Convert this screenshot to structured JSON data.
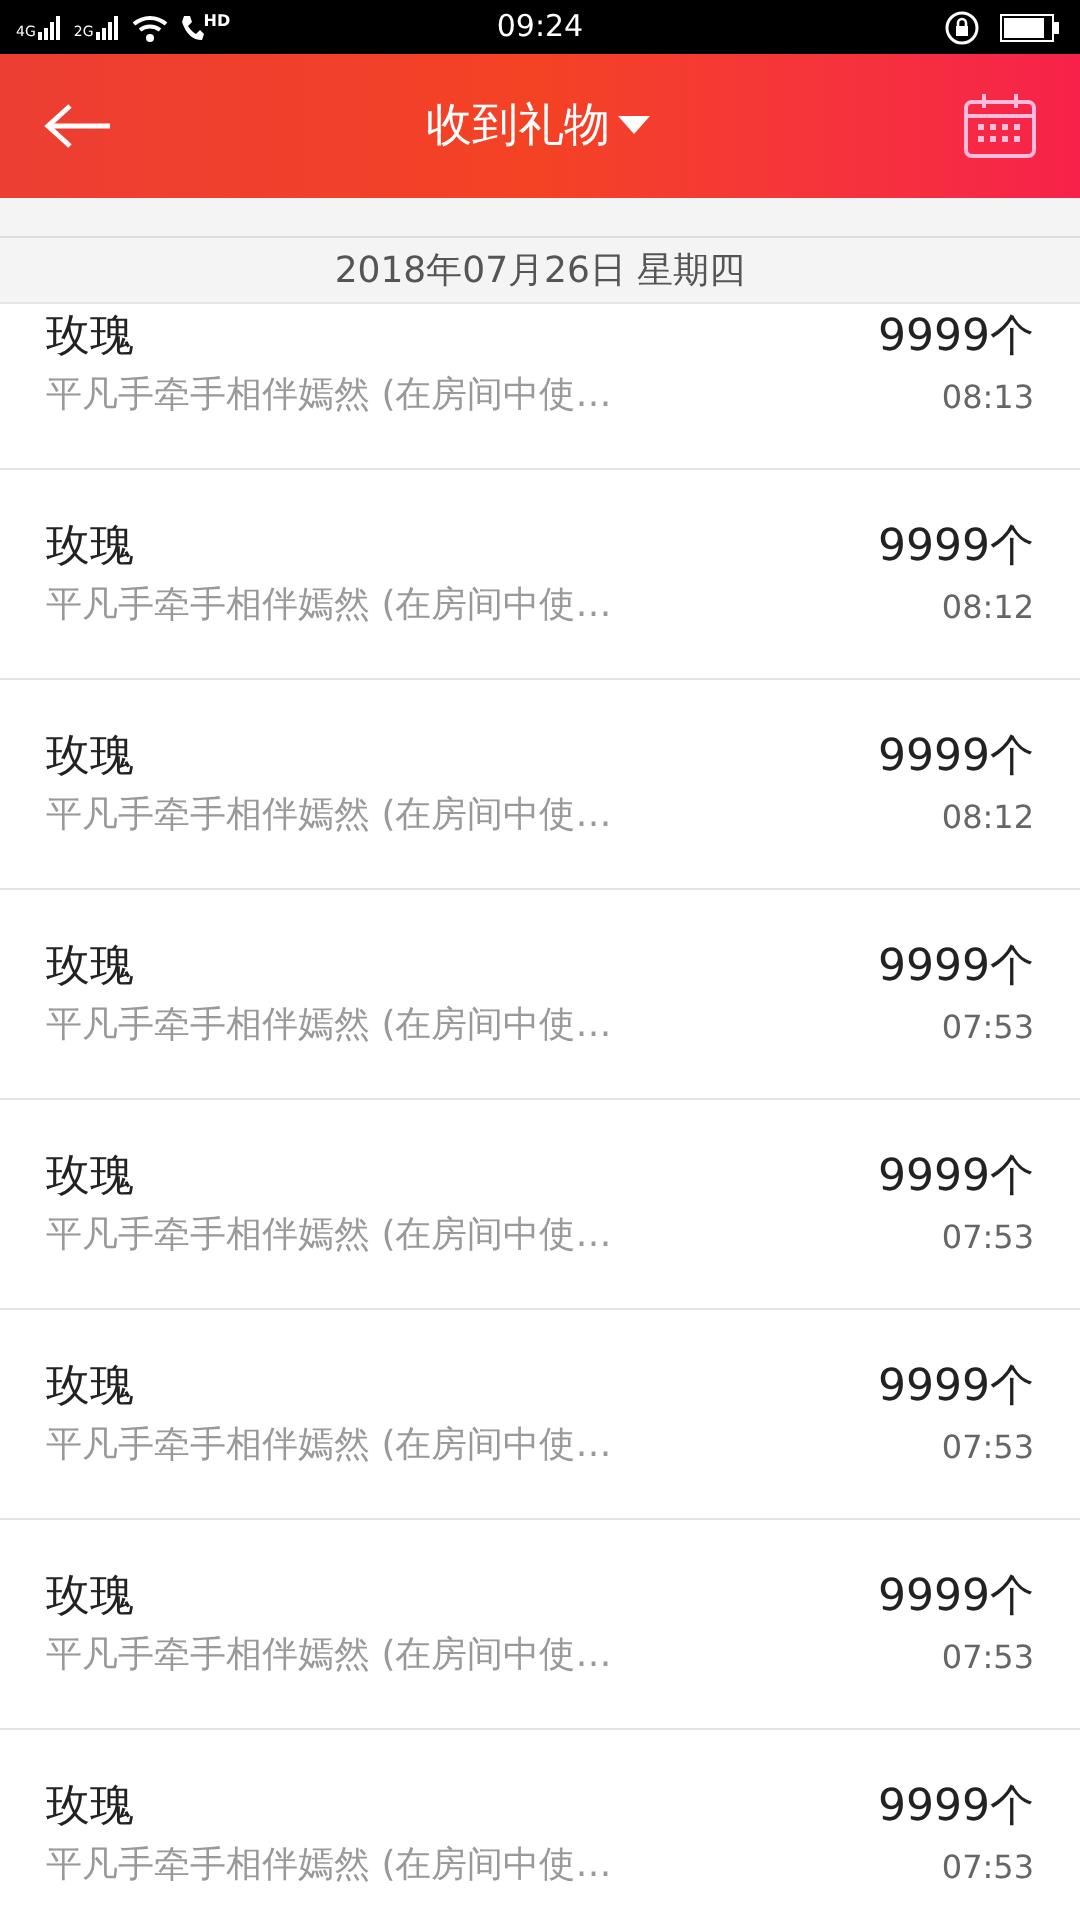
{
  "status_bar": {
    "time": "09:24",
    "network_1": "4G",
    "network_2": "2G",
    "call_label": "HD"
  },
  "header": {
    "title": "收到礼物"
  },
  "date_header": "2018年07月26日 星期四",
  "rows": [
    {
      "name": "玫瑰",
      "detail": "平凡手牵手相伴嫣然 (在房间中使…",
      "count": "9999个",
      "time": "08:13"
    },
    {
      "name": "玫瑰",
      "detail": "平凡手牵手相伴嫣然 (在房间中使…",
      "count": "9999个",
      "time": "08:12"
    },
    {
      "name": "玫瑰",
      "detail": "平凡手牵手相伴嫣然 (在房间中使…",
      "count": "9999个",
      "time": "08:12"
    },
    {
      "name": "玫瑰",
      "detail": "平凡手牵手相伴嫣然 (在房间中使…",
      "count": "9999个",
      "time": "07:53"
    },
    {
      "name": "玫瑰",
      "detail": "平凡手牵手相伴嫣然 (在房间中使…",
      "count": "9999个",
      "time": "07:53"
    },
    {
      "name": "玫瑰",
      "detail": "平凡手牵手相伴嫣然 (在房间中使…",
      "count": "9999个",
      "time": "07:53"
    },
    {
      "name": "玫瑰",
      "detail": "平凡手牵手相伴嫣然 (在房间中使…",
      "count": "9999个",
      "time": "07:53"
    },
    {
      "name": "玫瑰",
      "detail": "平凡手牵手相伴嫣然 (在房间中使…",
      "count": "9999个",
      "time": "07:53"
    }
  ]
}
